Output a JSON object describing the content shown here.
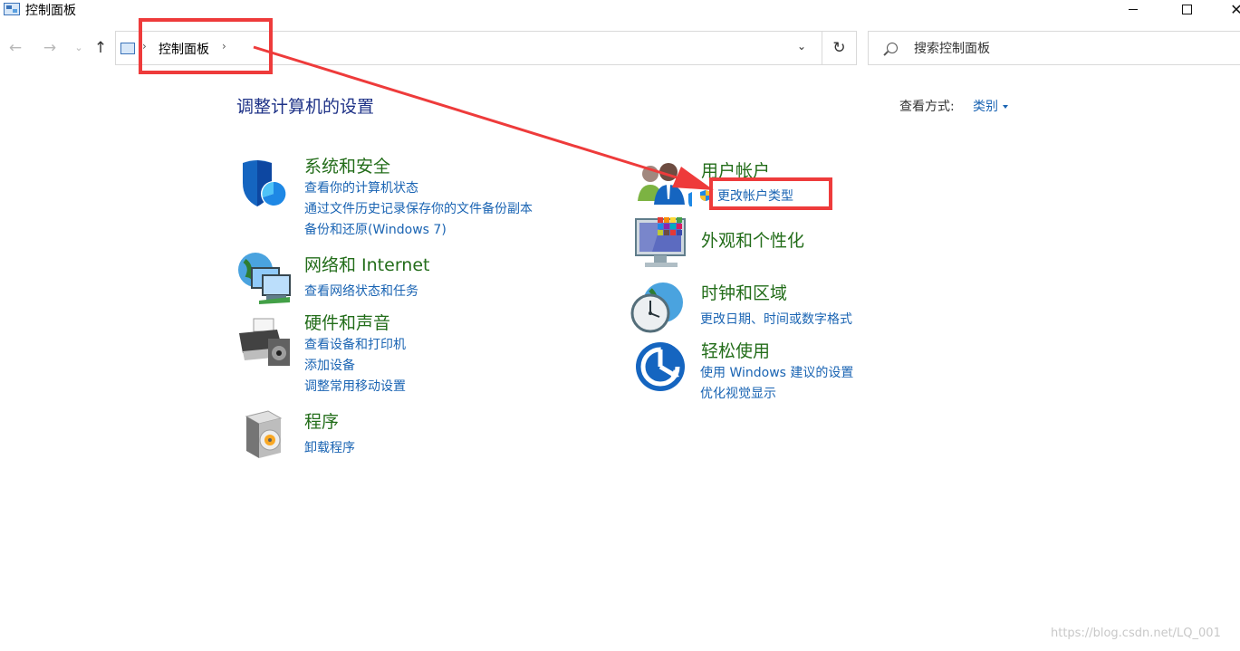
{
  "window": {
    "title": "控制面板",
    "close_glyph": "✕"
  },
  "nav": {
    "back_glyph": "←",
    "forward_glyph": "→",
    "recent_glyph": "⌄",
    "up_glyph": "↑",
    "breadcrumb_sep": "›",
    "breadcrumb": "控制面板",
    "dropdown_glyph": "⌄",
    "refresh_glyph": "↻",
    "search_placeholder": "搜索控制面板"
  },
  "content": {
    "page_title": "调整计算机的设置",
    "view_label": "查看方式:",
    "view_value": "类别"
  },
  "categories": {
    "system": {
      "title": "系统和安全",
      "links": [
        "查看你的计算机状态",
        "通过文件历史记录保存你的文件备份副本",
        "备份和还原(Windows 7)"
      ]
    },
    "network": {
      "title": "网络和 Internet",
      "links": [
        "查看网络状态和任务"
      ]
    },
    "hardware": {
      "title": "硬件和声音",
      "links": [
        "查看设备和打印机",
        "添加设备",
        "调整常用移动设置"
      ]
    },
    "programs": {
      "title": "程序",
      "links": [
        "卸载程序"
      ]
    },
    "users": {
      "title": "用户帐户",
      "links": [
        "更改帐户类型"
      ]
    },
    "appearance": {
      "title": "外观和个性化",
      "links": []
    },
    "clock": {
      "title": "时钟和区域",
      "links": [
        "更改日期、时间或数字格式"
      ]
    },
    "ease": {
      "title": "轻松使用",
      "links": [
        "使用 Windows 建议的设置",
        "优化视觉显示"
      ]
    }
  },
  "watermark": "https://blog.csdn.net/LQ_001",
  "colors": {
    "link": "#1a64b3",
    "category_title": "#236d1a",
    "page_title": "#1e3287",
    "annotation": "#ee3b3b"
  }
}
